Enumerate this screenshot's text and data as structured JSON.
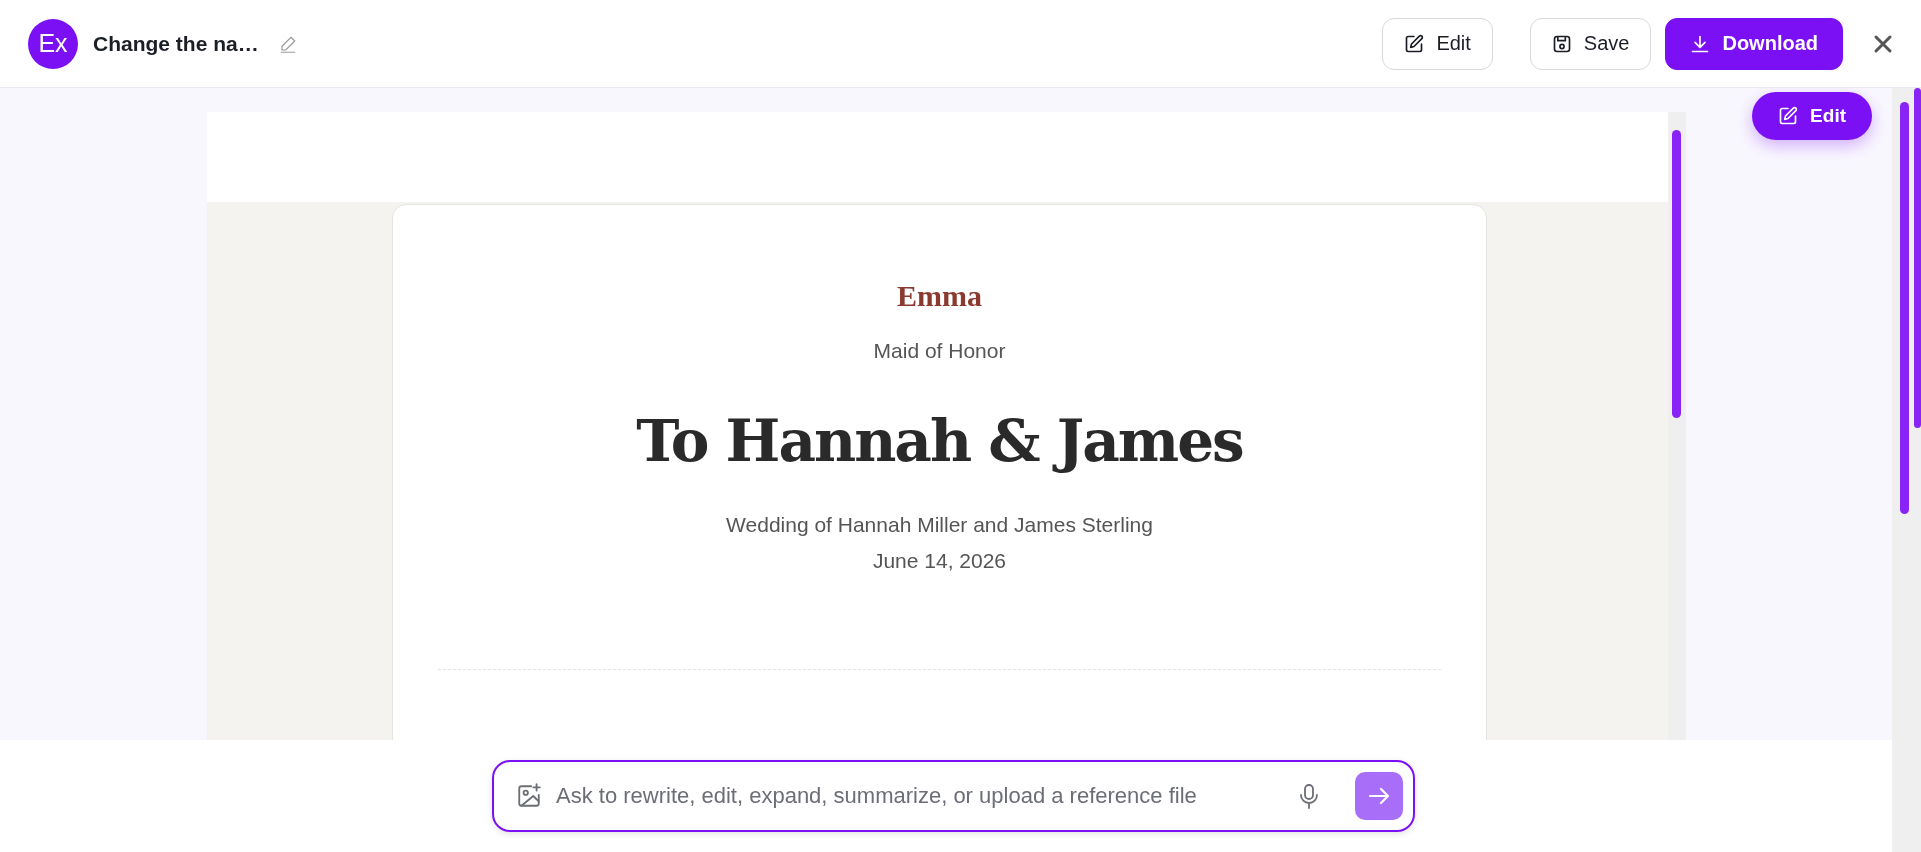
{
  "header": {
    "avatar": "Ex",
    "title": "Change the na…",
    "buttons": [
      {
        "label": "Edit",
        "kind": "edit",
        "primary": false
      },
      {
        "label": "Save",
        "kind": "save",
        "primary": false
      },
      {
        "label": "Download",
        "kind": "download",
        "primary": true
      }
    ]
  },
  "floating_button": {
    "label": "Edit"
  },
  "document": {
    "author": "Emma",
    "role": "Maid of Honor",
    "heading": "To Hannah & James",
    "subtitle": "Wedding of Hannah Miller and James Sterling",
    "date": "June 14, 2026"
  },
  "chat": {
    "placeholder": "Ask to rewrite, edit, expand, summarize, or upload a reference file"
  }
}
